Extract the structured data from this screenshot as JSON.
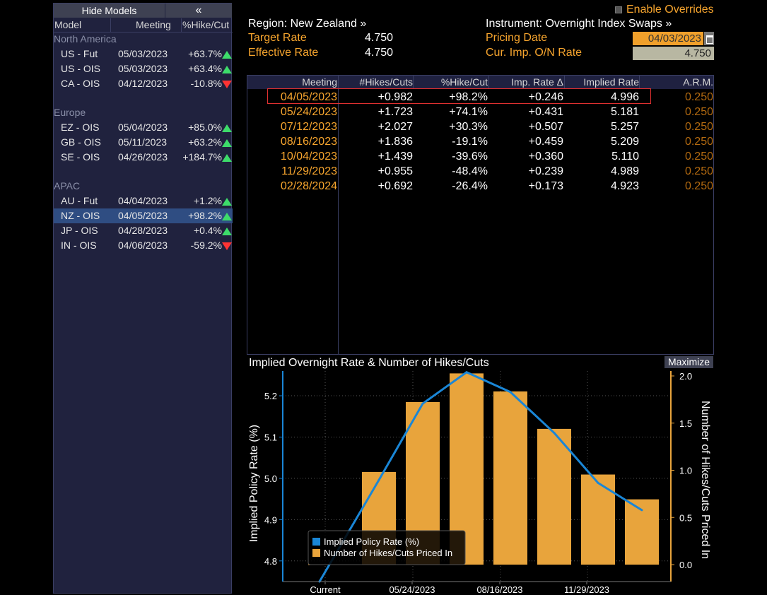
{
  "left_panel": {
    "hide_models_label": "Hide Models",
    "collapse_label": "«",
    "headers": {
      "model": "Model",
      "meeting": "Meeting",
      "pct": "%Hike/Cut"
    },
    "groups": [
      {
        "name": "North America",
        "rows": [
          {
            "model": "US - Fut",
            "meeting": "05/03/2023",
            "pct": "+63.7%",
            "dir": "up"
          },
          {
            "model": "US - OIS",
            "meeting": "05/03/2023",
            "pct": "+63.4%",
            "dir": "up"
          },
          {
            "model": "CA - OIS",
            "meeting": "04/12/2023",
            "pct": "-10.8%",
            "dir": "down"
          }
        ]
      },
      {
        "name": "Europe",
        "rows": [
          {
            "model": "EZ - OIS",
            "meeting": "05/04/2023",
            "pct": "+85.0%",
            "dir": "up"
          },
          {
            "model": "GB - OIS",
            "meeting": "05/11/2023",
            "pct": "+63.2%",
            "dir": "up"
          },
          {
            "model": "SE - OIS",
            "meeting": "04/26/2023",
            "pct": "+184.7%",
            "dir": "up"
          }
        ]
      },
      {
        "name": "APAC",
        "rows": [
          {
            "model": "AU - Fut",
            "meeting": "04/04/2023",
            "pct": "+1.2%",
            "dir": "up"
          },
          {
            "model": "NZ - OIS",
            "meeting": "04/05/2023",
            "pct": "+98.2%",
            "dir": "up",
            "selected": true
          },
          {
            "model": "JP - OIS",
            "meeting": "04/28/2023",
            "pct": "+0.4%",
            "dir": "up"
          },
          {
            "model": "IN - OIS",
            "meeting": "04/06/2023",
            "pct": "-59.2%",
            "dir": "down"
          }
        ]
      }
    ]
  },
  "info": {
    "region": "Region: New Zealand »",
    "instrument": "Instrument: Overnight Index Swaps »",
    "enable_overrides": "Enable Overrides",
    "target_rate_label": "Target Rate",
    "target_rate": "4.750",
    "effective_rate_label": "Effective Rate",
    "effective_rate": "4.750",
    "pricing_date_label": "Pricing Date",
    "pricing_date": "04/03/2023",
    "cur_imp_label": "Cur. Imp. O/N Rate",
    "cur_imp": "4.750"
  },
  "table": {
    "headers": [
      "Meeting",
      "#Hikes/Cuts",
      "%Hike/Cut",
      "Imp. Rate Δ",
      "Implied Rate",
      "A.R.M."
    ],
    "rows": [
      [
        "04/05/2023",
        "+0.982",
        "+98.2%",
        "+0.246",
        "4.996",
        "0.250"
      ],
      [
        "05/24/2023",
        "+1.723",
        "+74.1%",
        "+0.431",
        "5.181",
        "0.250"
      ],
      [
        "07/12/2023",
        "+2.027",
        "+30.3%",
        "+0.507",
        "5.257",
        "0.250"
      ],
      [
        "08/16/2023",
        "+1.836",
        "-19.1%",
        "+0.459",
        "5.209",
        "0.250"
      ],
      [
        "10/04/2023",
        "+1.439",
        "-39.6%",
        "+0.360",
        "5.110",
        "0.250"
      ],
      [
        "11/29/2023",
        "+0.955",
        "-48.4%",
        "+0.239",
        "4.989",
        "0.250"
      ],
      [
        "02/28/2024",
        "+0.692",
        "-26.4%",
        "+0.173",
        "4.923",
        "0.250"
      ]
    ]
  },
  "chart": {
    "title": "Implied Overnight Rate & Number of Hikes/Cuts",
    "maximize_label": "Maximize"
  },
  "chart_data": {
    "type": "bar",
    "categories": [
      "Current",
      "04/05/2023",
      "05/24/2023",
      "07/12/2023",
      "08/16/2023",
      "10/04/2023",
      "11/29/2023",
      "02/28/2024"
    ],
    "x_tick_labels": [
      "Current",
      "05/24/2023",
      "08/16/2023",
      "11/29/2023"
    ],
    "series": [
      {
        "name": "Implied Policy Rate (%)",
        "type": "line",
        "axis": "left",
        "color": "#1a86d6",
        "values": [
          4.75,
          4.996,
          5.181,
          5.257,
          5.209,
          5.11,
          4.989,
          4.923
        ]
      },
      {
        "name": "Number of Hikes/Cuts Priced In",
        "type": "bar",
        "axis": "right",
        "color": "#e8a43c",
        "values": [
          0,
          0.982,
          1.723,
          2.027,
          1.836,
          1.439,
          0.955,
          0.692
        ]
      }
    ],
    "ylabel": "Implied Policy Rate (%)",
    "y2label": "Number of Hikes/Cuts Priced In",
    "y_ticks": [
      "4.8",
      "4.9",
      "5.0",
      "5.1",
      "5.2"
    ],
    "y2_ticks": [
      "0.0",
      "0.5",
      "1.0",
      "1.5",
      "2.0"
    ],
    "ylim": [
      4.75,
      5.26
    ],
    "y2lim": [
      0,
      2.03
    ],
    "grid": true,
    "legend_position": "bottom-left",
    "legend": [
      "Implied Policy Rate (%)",
      "Number of Hikes/Cuts Priced In"
    ]
  }
}
